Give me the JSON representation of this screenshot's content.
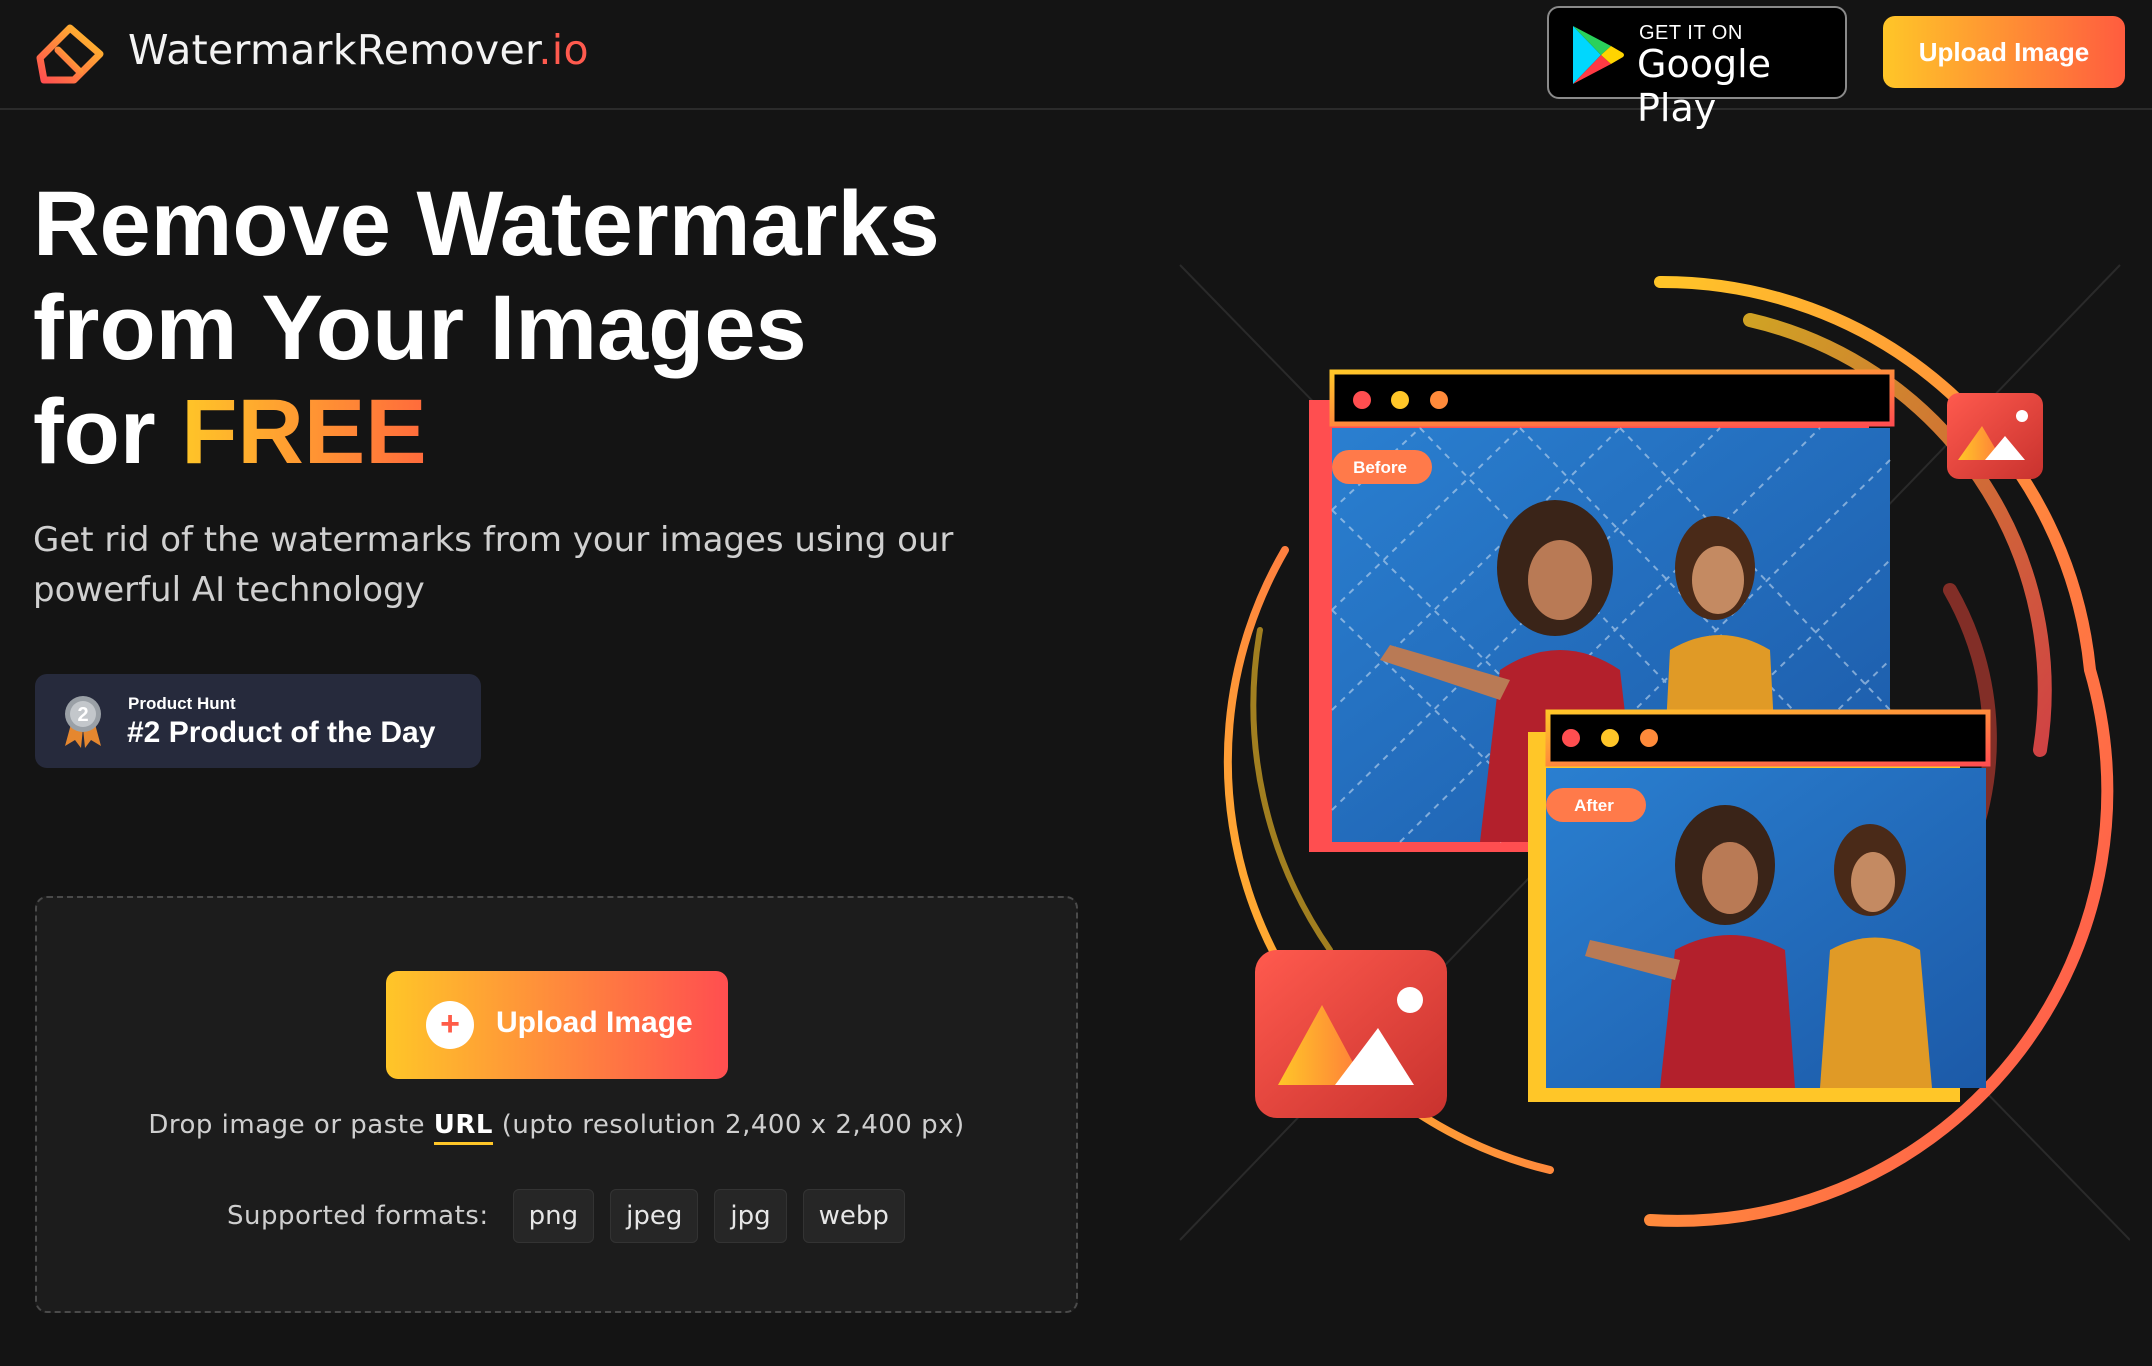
{
  "header": {
    "brand_name": "WatermarkRemover",
    "brand_tld": ".io",
    "gplay_top": "GET IT ON",
    "gplay_store": "Google Play",
    "upload_button": "Upload Image"
  },
  "hero": {
    "headline_line1": "Remove Watermarks",
    "headline_line2": "from Your Images",
    "headline_line3_prefix": "for ",
    "headline_free": "FREE",
    "subtitle": "Get rid of the watermarks from your images using our powerful AI technology"
  },
  "product_hunt": {
    "rank": "2",
    "label": "Product Hunt",
    "title": "#2 Product of the Day"
  },
  "dropzone": {
    "upload_button": "Upload Image",
    "hint_prefix": "Drop image or paste ",
    "hint_url": "URL",
    "hint_suffix": " (upto resolution 2,400 x 2,400 px)",
    "formats_label": "Supported formats:",
    "formats": [
      "png",
      "jpeg",
      "jpg",
      "webp"
    ]
  },
  "illustration": {
    "before_label": "Before",
    "after_label": "After"
  },
  "colors": {
    "accent_yellow": "#ffc628",
    "accent_red": "#ff4e50",
    "background": "#141414"
  }
}
